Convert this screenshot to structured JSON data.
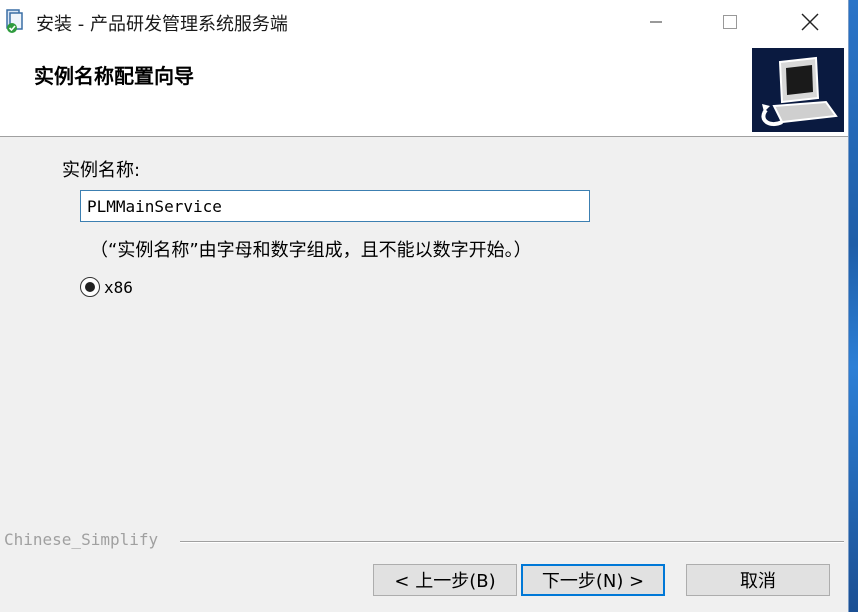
{
  "window": {
    "title": "安装 - 产品研发管理系统服务端"
  },
  "header": {
    "title": "实例名称配置向导"
  },
  "form": {
    "instance_name_label": "实例名称:",
    "instance_name_value": "PLMMainService",
    "hint": "（“实例名称”由字母和数字组成，且不能以数字开始。）",
    "platform_option_label": "x86",
    "platform_option_selected": true
  },
  "footer": {
    "language_label": "Chinese_Simplify",
    "back_label": "< 上一步(B)",
    "next_label": "下一步(N) >",
    "cancel_label": "取消"
  },
  "icons": {
    "app": "installer-icon",
    "minimize": "minimize-icon",
    "maximize": "maximize-icon",
    "close": "close-icon",
    "wizard": "computer-install-icon"
  }
}
